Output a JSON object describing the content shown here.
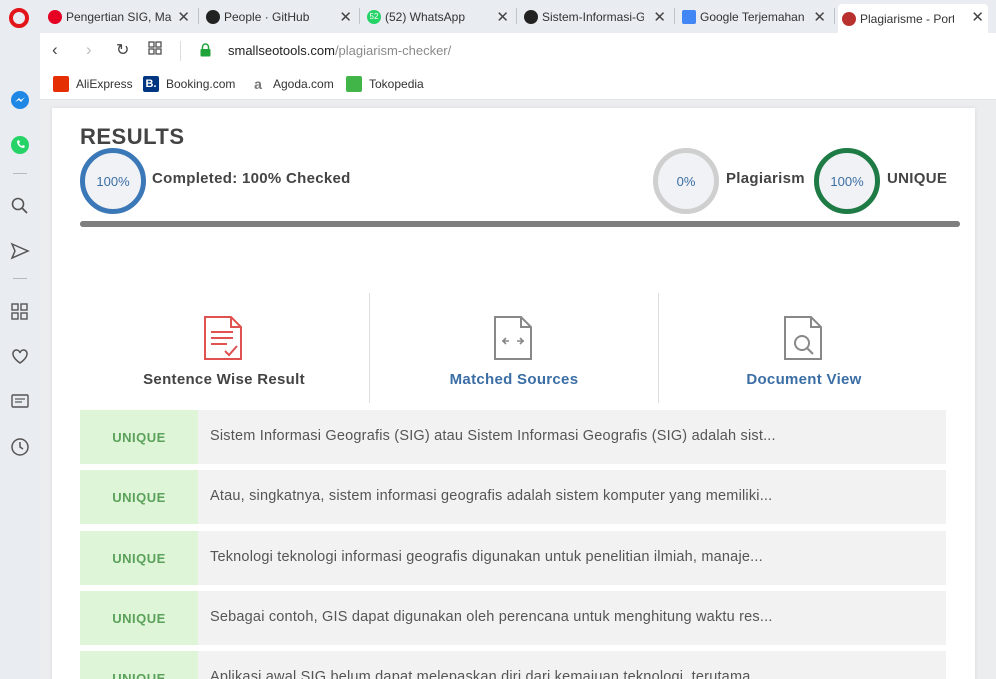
{
  "browser": {
    "tabs": [
      {
        "title": "Pengertian SIG, Ma",
        "icon": "pinterest-icon",
        "color": "#e60023"
      },
      {
        "title": "People · GitHub",
        "icon": "github-icon",
        "color": "#222222"
      },
      {
        "title": "(52) WhatsApp",
        "icon": "whatsapp-icon",
        "color": "#25d366"
      },
      {
        "title": "Sistem-Informasi-G",
        "icon": "github-icon",
        "color": "#222222"
      },
      {
        "title": "Google Terjemahan",
        "icon": "google-translate-icon",
        "color": "#4285f4"
      },
      {
        "title": "Plagiarisme - Portal",
        "icon": "portal-icon",
        "color": "#b8312f"
      }
    ],
    "whatsapp_count": "52",
    "url_host": "smallseotools.com",
    "url_path": "/plagiarism-checker/",
    "bookmarks": [
      {
        "label": "AliExpress",
        "icon": "aliexpress-icon",
        "color": "#e62e04"
      },
      {
        "label": "Booking.com",
        "icon": "booking-icon",
        "color": "#003580",
        "glyph": "B."
      },
      {
        "label": "Agoda.com",
        "icon": "agoda-icon",
        "color": "#777777",
        "glyph": "a"
      },
      {
        "label": "Tokopedia",
        "icon": "tokopedia-icon",
        "color": "#42b549"
      }
    ],
    "sidebar_icons": [
      "messenger-icon",
      "whatsapp-icon",
      "search-icon",
      "send-icon",
      "speed-dial-icon",
      "heart-icon",
      "news-icon",
      "history-icon"
    ]
  },
  "results": {
    "title": "RESULTS",
    "checked_ring": "100%",
    "checked_label": "Completed: 100% Checked",
    "checked_fraction": 1.0,
    "plagiarism_ring": "0%",
    "plagiarism_label": "Plagiarism",
    "unique_ring": "100%",
    "unique_label": "UNIQUE",
    "colors": {
      "checked": "#3b78b8",
      "plagiarism": "#cfcfcf",
      "unique": "#1e7b45",
      "link": "#3b6ea5"
    }
  },
  "views": [
    {
      "label": "Sentence Wise Result",
      "icon": "document-check-icon"
    },
    {
      "label": "Matched Sources",
      "icon": "compare-document-icon"
    },
    {
      "label": "Document View",
      "icon": "document-search-icon"
    }
  ],
  "sentences": [
    {
      "status": "UNIQUE",
      "text": "Sistem Informasi Geografis (SIG) atau Sistem Informasi Geografis (SIG) adalah sist..."
    },
    {
      "status": "UNIQUE",
      "text": "Atau, singkatnya, sistem informasi geografis adalah sistem komputer yang memiliki..."
    },
    {
      "status": "UNIQUE",
      "text": "Teknologi teknologi informasi geografis digunakan untuk penelitian ilmiah, manaje..."
    },
    {
      "status": "UNIQUE",
      "text": "Sebagai contoh, GIS dapat digunakan oleh perencana untuk menghitung waktu res..."
    },
    {
      "status": "UNIQUE",
      "text": "Aplikasi awal SIG belum dapat melepaskan diri dari kemajuan teknologi, terutama..."
    }
  ]
}
